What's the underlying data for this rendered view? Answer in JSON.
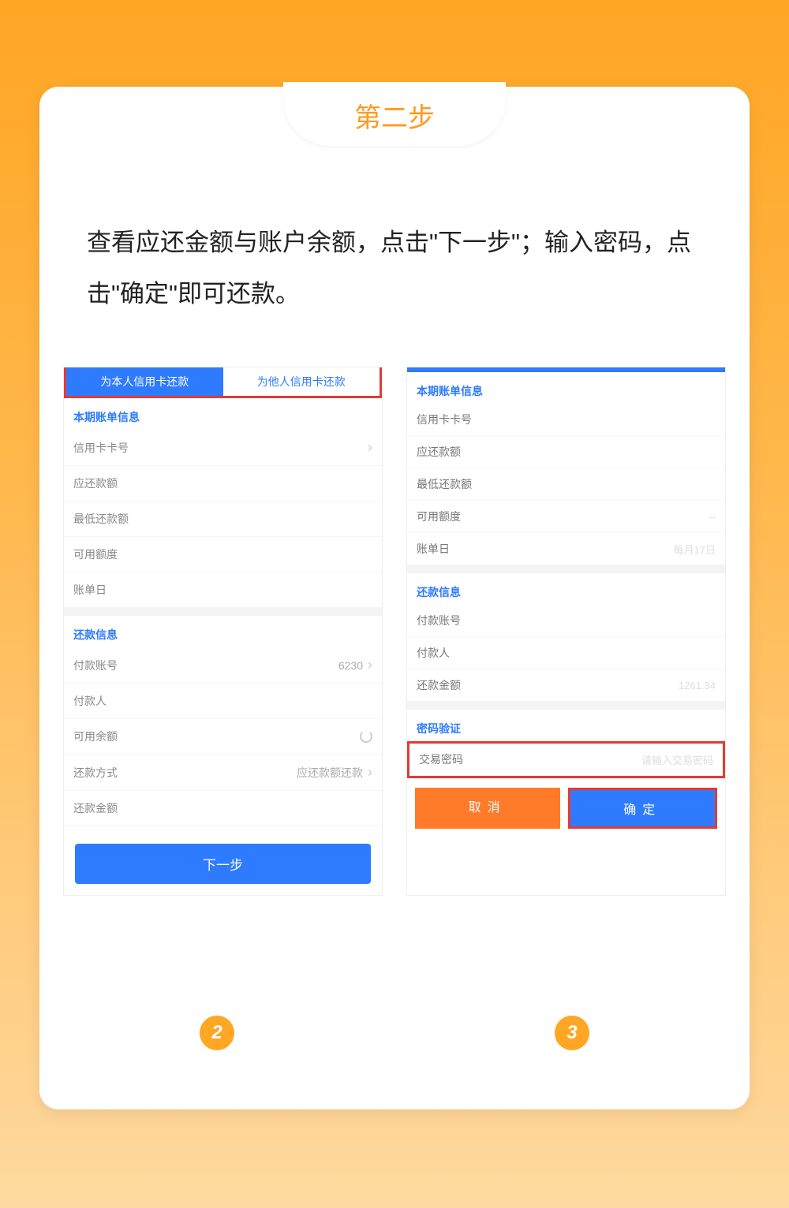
{
  "step_title": "第二步",
  "instructions": "查看应还金额与账户余额，点击\"下一步\"；输入密码，点击\"确定\"即可还款。",
  "left": {
    "tab_active": "为本人信用卡还款",
    "tab_inactive": "为他人信用卡还款",
    "section_bill": "本期账单信息",
    "card_no": "信用卡卡号",
    "due_amt": "应还款额",
    "min_amt": "最低还款额",
    "credit": "可用额度",
    "bill_day": "账单日",
    "section_repay": "还款信息",
    "pay_acct": "付款账号",
    "pay_acct_val": "6230",
    "payer": "付款人",
    "avail": "可用余额",
    "method": "还款方式",
    "method_val": "应还款额还款",
    "repay_amt": "还款金额",
    "next_btn": "下一步"
  },
  "right": {
    "section_bill": "本期账单信息",
    "card_no": "信用卡卡号",
    "due_amt": "应还款额",
    "min_amt": "最低还款额",
    "credit": "可用额度",
    "bill_day": "账单日",
    "bill_day_val": "每月17日",
    "section_repay": "还款信息",
    "pay_acct": "付款账号",
    "payer": "付款人",
    "repay_amt": "还款金额",
    "repay_amt_val": "1261.34",
    "section_pwd": "密码验证",
    "pwd_label": "交易密码",
    "pwd_placeholder": "请输入交易密码",
    "cancel": "取消",
    "confirm": "确定"
  },
  "badges": {
    "left": "2",
    "right": "3"
  }
}
